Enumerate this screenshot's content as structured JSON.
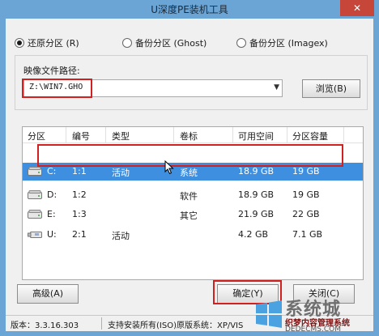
{
  "window": {
    "title": "U深度PE装机工具",
    "close_glyph": "✕"
  },
  "modes": [
    {
      "label": "还原分区 (R)",
      "selected": true
    },
    {
      "label": "备份分区 (Ghost)",
      "selected": false
    },
    {
      "label": "备份分区 (Imagex)",
      "selected": false
    }
  ],
  "image_path": {
    "label": "映像文件路径:",
    "value": "Z:\\WIN7.GHO",
    "browse_label": "浏览(B)"
  },
  "table": {
    "headers": [
      "分区",
      "编号",
      "类型",
      "卷标",
      "可用空间",
      "分区容量"
    ],
    "rows": [
      {
        "drive": "C:",
        "num": "1:1",
        "type": "活动",
        "label": "系统",
        "free": "18.9 GB",
        "size": "19 GB",
        "selected": true,
        "icon": "hard-disk-icon"
      },
      {
        "drive": "D:",
        "num": "1:2",
        "type": "",
        "label": "软件",
        "free": "18.9 GB",
        "size": "19 GB",
        "selected": false,
        "icon": "hard-disk-icon"
      },
      {
        "drive": "E:",
        "num": "1:3",
        "type": "",
        "label": "其它",
        "free": "21.9 GB",
        "size": "22 GB",
        "selected": false,
        "icon": "hard-disk-icon"
      },
      {
        "drive": "U:",
        "num": "2:1",
        "type": "活动",
        "label": "",
        "free": "4.2 GB",
        "size": "7.1 GB",
        "selected": false,
        "icon": "usb-drive-icon"
      }
    ]
  },
  "buttons": {
    "advanced": "高级(A)",
    "ok": "确定(Y)",
    "close": "关闭(C)"
  },
  "status": {
    "version": "版本：3.3.16.303",
    "support": "支持安装所有(ISO)原版系统：XP/VIS"
  },
  "watermark": {
    "big": "系统城",
    "small": "织梦内容管理系统",
    "url": "DEDECMS.COM"
  },
  "colors": {
    "title_bg": "#6aa5d6",
    "selection": "#3f8fe0",
    "highlight_box": "#d02020",
    "close_button": "#c7463a"
  }
}
